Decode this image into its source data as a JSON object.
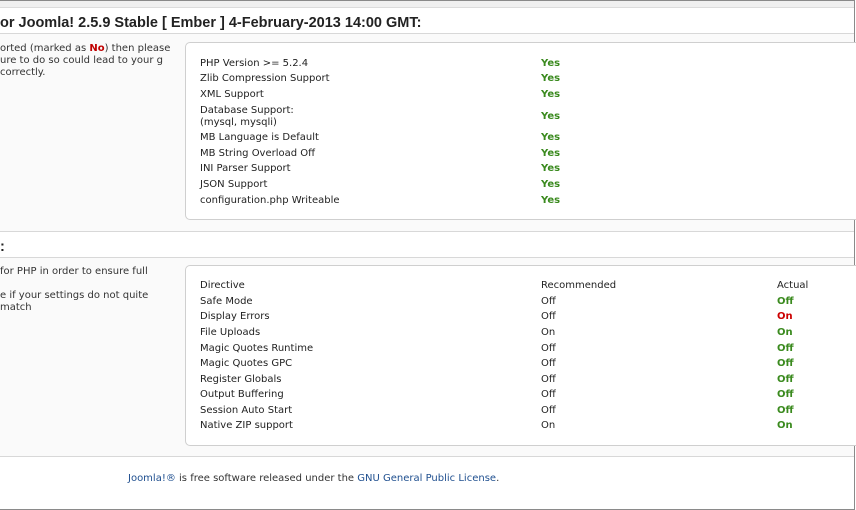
{
  "header": {
    "title": "or Joomla! 2.5.9 Stable [ Ember ] 4-February-2013 14:00 GMT:"
  },
  "preinstall": {
    "intro_before": "orted (marked as ",
    "intro_no": "No",
    "intro_after": ") then please ure to do so could lead to your g correctly.",
    "items": [
      {
        "label": "PHP Version >= 5.2.4",
        "status": "Yes"
      },
      {
        "label": "Zlib Compression Support",
        "status": "Yes"
      },
      {
        "label": "XML Support",
        "status": "Yes"
      },
      {
        "label": "Database Support:",
        "label2": "(mysql, mysqli)",
        "status": "Yes"
      },
      {
        "label": "MB Language is Default",
        "status": "Yes"
      },
      {
        "label": "MB String Overload Off",
        "status": "Yes"
      },
      {
        "label": "INI Parser Support",
        "status": "Yes"
      },
      {
        "label": "JSON Support",
        "status": "Yes"
      },
      {
        "label": "configuration.php Writeable",
        "status": "Yes"
      }
    ]
  },
  "recommended": {
    "section_label": ":",
    "intro_line1": " for PHP in order to ensure full",
    "intro_line2": "e if your settings do not quite match",
    "headers": {
      "directive": "Directive",
      "recommended": "Recommended",
      "actual": "Actual"
    },
    "rows": [
      {
        "directive": "Safe Mode",
        "recommended": "Off",
        "actual": "Off",
        "ok": true
      },
      {
        "directive": "Display Errors",
        "recommended": "Off",
        "actual": "On",
        "ok": false
      },
      {
        "directive": "File Uploads",
        "recommended": "On",
        "actual": "On",
        "ok": true
      },
      {
        "directive": "Magic Quotes Runtime",
        "recommended": "Off",
        "actual": "Off",
        "ok": true
      },
      {
        "directive": "Magic Quotes GPC",
        "recommended": "Off",
        "actual": "Off",
        "ok": true
      },
      {
        "directive": "Register Globals",
        "recommended": "Off",
        "actual": "Off",
        "ok": true
      },
      {
        "directive": "Output Buffering",
        "recommended": "Off",
        "actual": "Off",
        "ok": true
      },
      {
        "directive": "Session Auto Start",
        "recommended": "Off",
        "actual": "Off",
        "ok": true
      },
      {
        "directive": "Native ZIP support",
        "recommended": "On",
        "actual": "On",
        "ok": true
      }
    ]
  },
  "footer": {
    "brand": "Joomla!®",
    "middle": " is free software released under the ",
    "license": "GNU General Public License",
    "end": "."
  },
  "colors": {
    "ok": "#3a8a1e",
    "bad": "#cc0000",
    "link": "#1f4f8f"
  }
}
